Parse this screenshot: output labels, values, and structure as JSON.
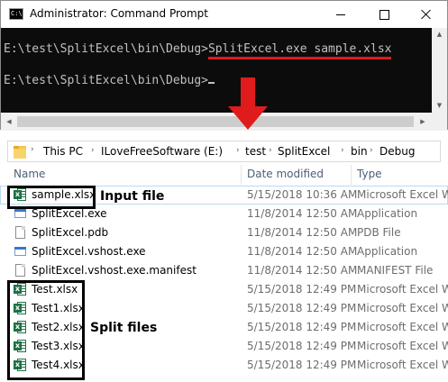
{
  "cmd": {
    "title": "Administrator: Command Prompt",
    "icon_label": "C:\\",
    "prompt1": "E:\\test\\SplitExcel\\bin\\Debug>",
    "command": "SplitExcel.exe sample.xlsx",
    "prompt2": "E:\\test\\SplitExcel\\bin\\Debug>",
    "window_buttons": [
      "minimize-icon",
      "maximize-icon",
      "close-icon"
    ]
  },
  "explorer": {
    "breadcrumb": [
      "This PC",
      "ILoveFreeSoftware (E:)",
      "test",
      "SplitExcel",
      "bin",
      "Debug"
    ],
    "columns": {
      "name": "Name",
      "date": "Date modified",
      "type": "Type"
    },
    "files": [
      {
        "name": "sample.xlsx",
        "date": "5/15/2018 10:36 AM",
        "type": "Microsoft Excel Worksheet",
        "icon": "excel-icon"
      },
      {
        "name": "SplitExcel.exe",
        "date": "11/8/2014 12:50 AM",
        "type": "Application",
        "icon": "exe-icon"
      },
      {
        "name": "SplitExcel.pdb",
        "date": "11/8/2014 12:50 AM",
        "type": "PDB File",
        "icon": "file-icon"
      },
      {
        "name": "SplitExcel.vshost.exe",
        "date": "11/8/2014 12:50 AM",
        "type": "Application",
        "icon": "exe-icon"
      },
      {
        "name": "SplitExcel.vshost.exe.manifest",
        "date": "11/8/2014 12:50 AM",
        "type": "MANIFEST File",
        "icon": "file-icon"
      },
      {
        "name": "Test.xlsx",
        "date": "5/15/2018 12:49 PM",
        "type": "Microsoft Excel Worksheet",
        "icon": "excel-icon"
      },
      {
        "name": "Test1.xlsx",
        "date": "5/15/2018 12:49 PM",
        "type": "Microsoft Excel Worksheet",
        "icon": "excel-icon"
      },
      {
        "name": "Test2.xlsx",
        "date": "5/15/2018 12:49 PM",
        "type": "Microsoft Excel Worksheet",
        "icon": "excel-icon"
      },
      {
        "name": "Test3.xlsx",
        "date": "5/15/2018 12:49 PM",
        "type": "Microsoft Excel Worksheet",
        "icon": "excel-icon"
      },
      {
        "name": "Test4.xlsx",
        "date": "5/15/2018 12:49 PM",
        "type": "Microsoft Excel Worksheet",
        "icon": "excel-icon"
      }
    ]
  },
  "annotations": {
    "input_label": "Input file",
    "split_label": "Split files"
  },
  "colors": {
    "annotation_red": "#e01b1b",
    "excel_green": "#1e7145"
  }
}
